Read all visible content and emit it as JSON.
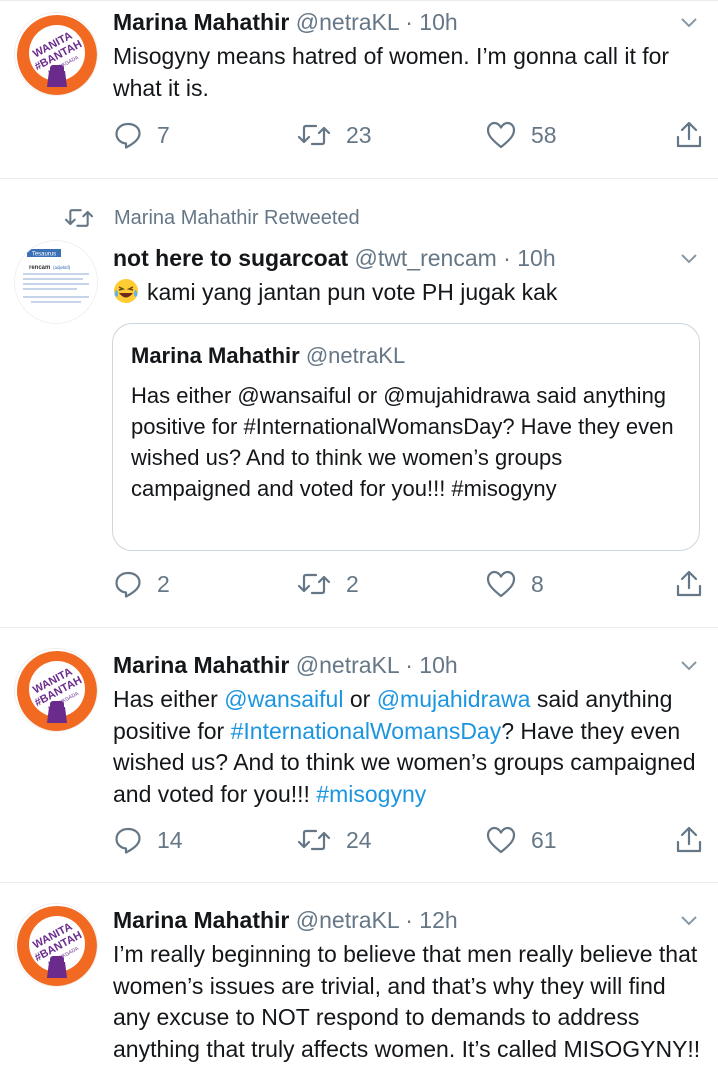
{
  "tweets": [
    {
      "name": "Marina Mahathir",
      "handle": "@netraKL",
      "dot": "·",
      "time": "10h",
      "text": "Misogyny means hatred of women. I’m gonna call it for what it is.",
      "replies": "7",
      "retweets": "23",
      "likes": "58"
    },
    {
      "retweet_context": "Marina Mahathir Retweeted",
      "name": "not here to sugarcoat",
      "handle": "@twt_rencam",
      "dot": "·",
      "time": "10h",
      "text": "kami yang jantan pun vote PH jugak kak",
      "quote": {
        "name": "Marina Mahathir",
        "handle": "@netraKL",
        "text": "Has either @wansaiful or @mujahidrawa said anything positive for #InternationalWomansDay? Have they even wished us? And to think we women’s groups campaigned and voted for you!!! #misogyny"
      },
      "replies": "2",
      "retweets": "2",
      "likes": "8"
    },
    {
      "name": "Marina Mahathir",
      "handle": "@netraKL",
      "dot": "·",
      "time": "10h",
      "text_parts": {
        "p1": "Has either ",
        "m1": "@wansaiful",
        "p2": " or ",
        "m2": "@mujahidrawa",
        "p3": " said anything positive for ",
        "h1": "#InternationalWomansDay",
        "p4": "? Have they even wished us? And to think we women’s groups campaigned and voted for you!!! ",
        "h2": "#misogyny"
      },
      "replies": "14",
      "retweets": "24",
      "likes": "61"
    },
    {
      "name": "Marina Mahathir",
      "handle": "@netraKL",
      "dot": "·",
      "time": "12h",
      "text": "I’m really beginning to believe that men really believe that women’s issues are trivial, and that’s why they will find any excuse to NOT respond to demands to address anything that truly affects women.  It’s called MISOGYNY!!"
    }
  ],
  "avatar_text": {
    "line1": "WANITA",
    "line2": "#BANTAH",
    "line3": "POLITIKGADA"
  },
  "tesaurus_avatar": {
    "title": "Tesaurus",
    "word": "rencam",
    "pos": "(adjektif)"
  },
  "colors": {
    "accent": "#1b95e0",
    "muted": "#657786",
    "avatar_orange": "#f26a21",
    "avatar_purple": "#6a2b8c"
  },
  "icons": [
    "reply-icon",
    "retweet-icon",
    "like-icon",
    "share-icon",
    "caret-down-icon",
    "laughing-crying-emoji"
  ]
}
